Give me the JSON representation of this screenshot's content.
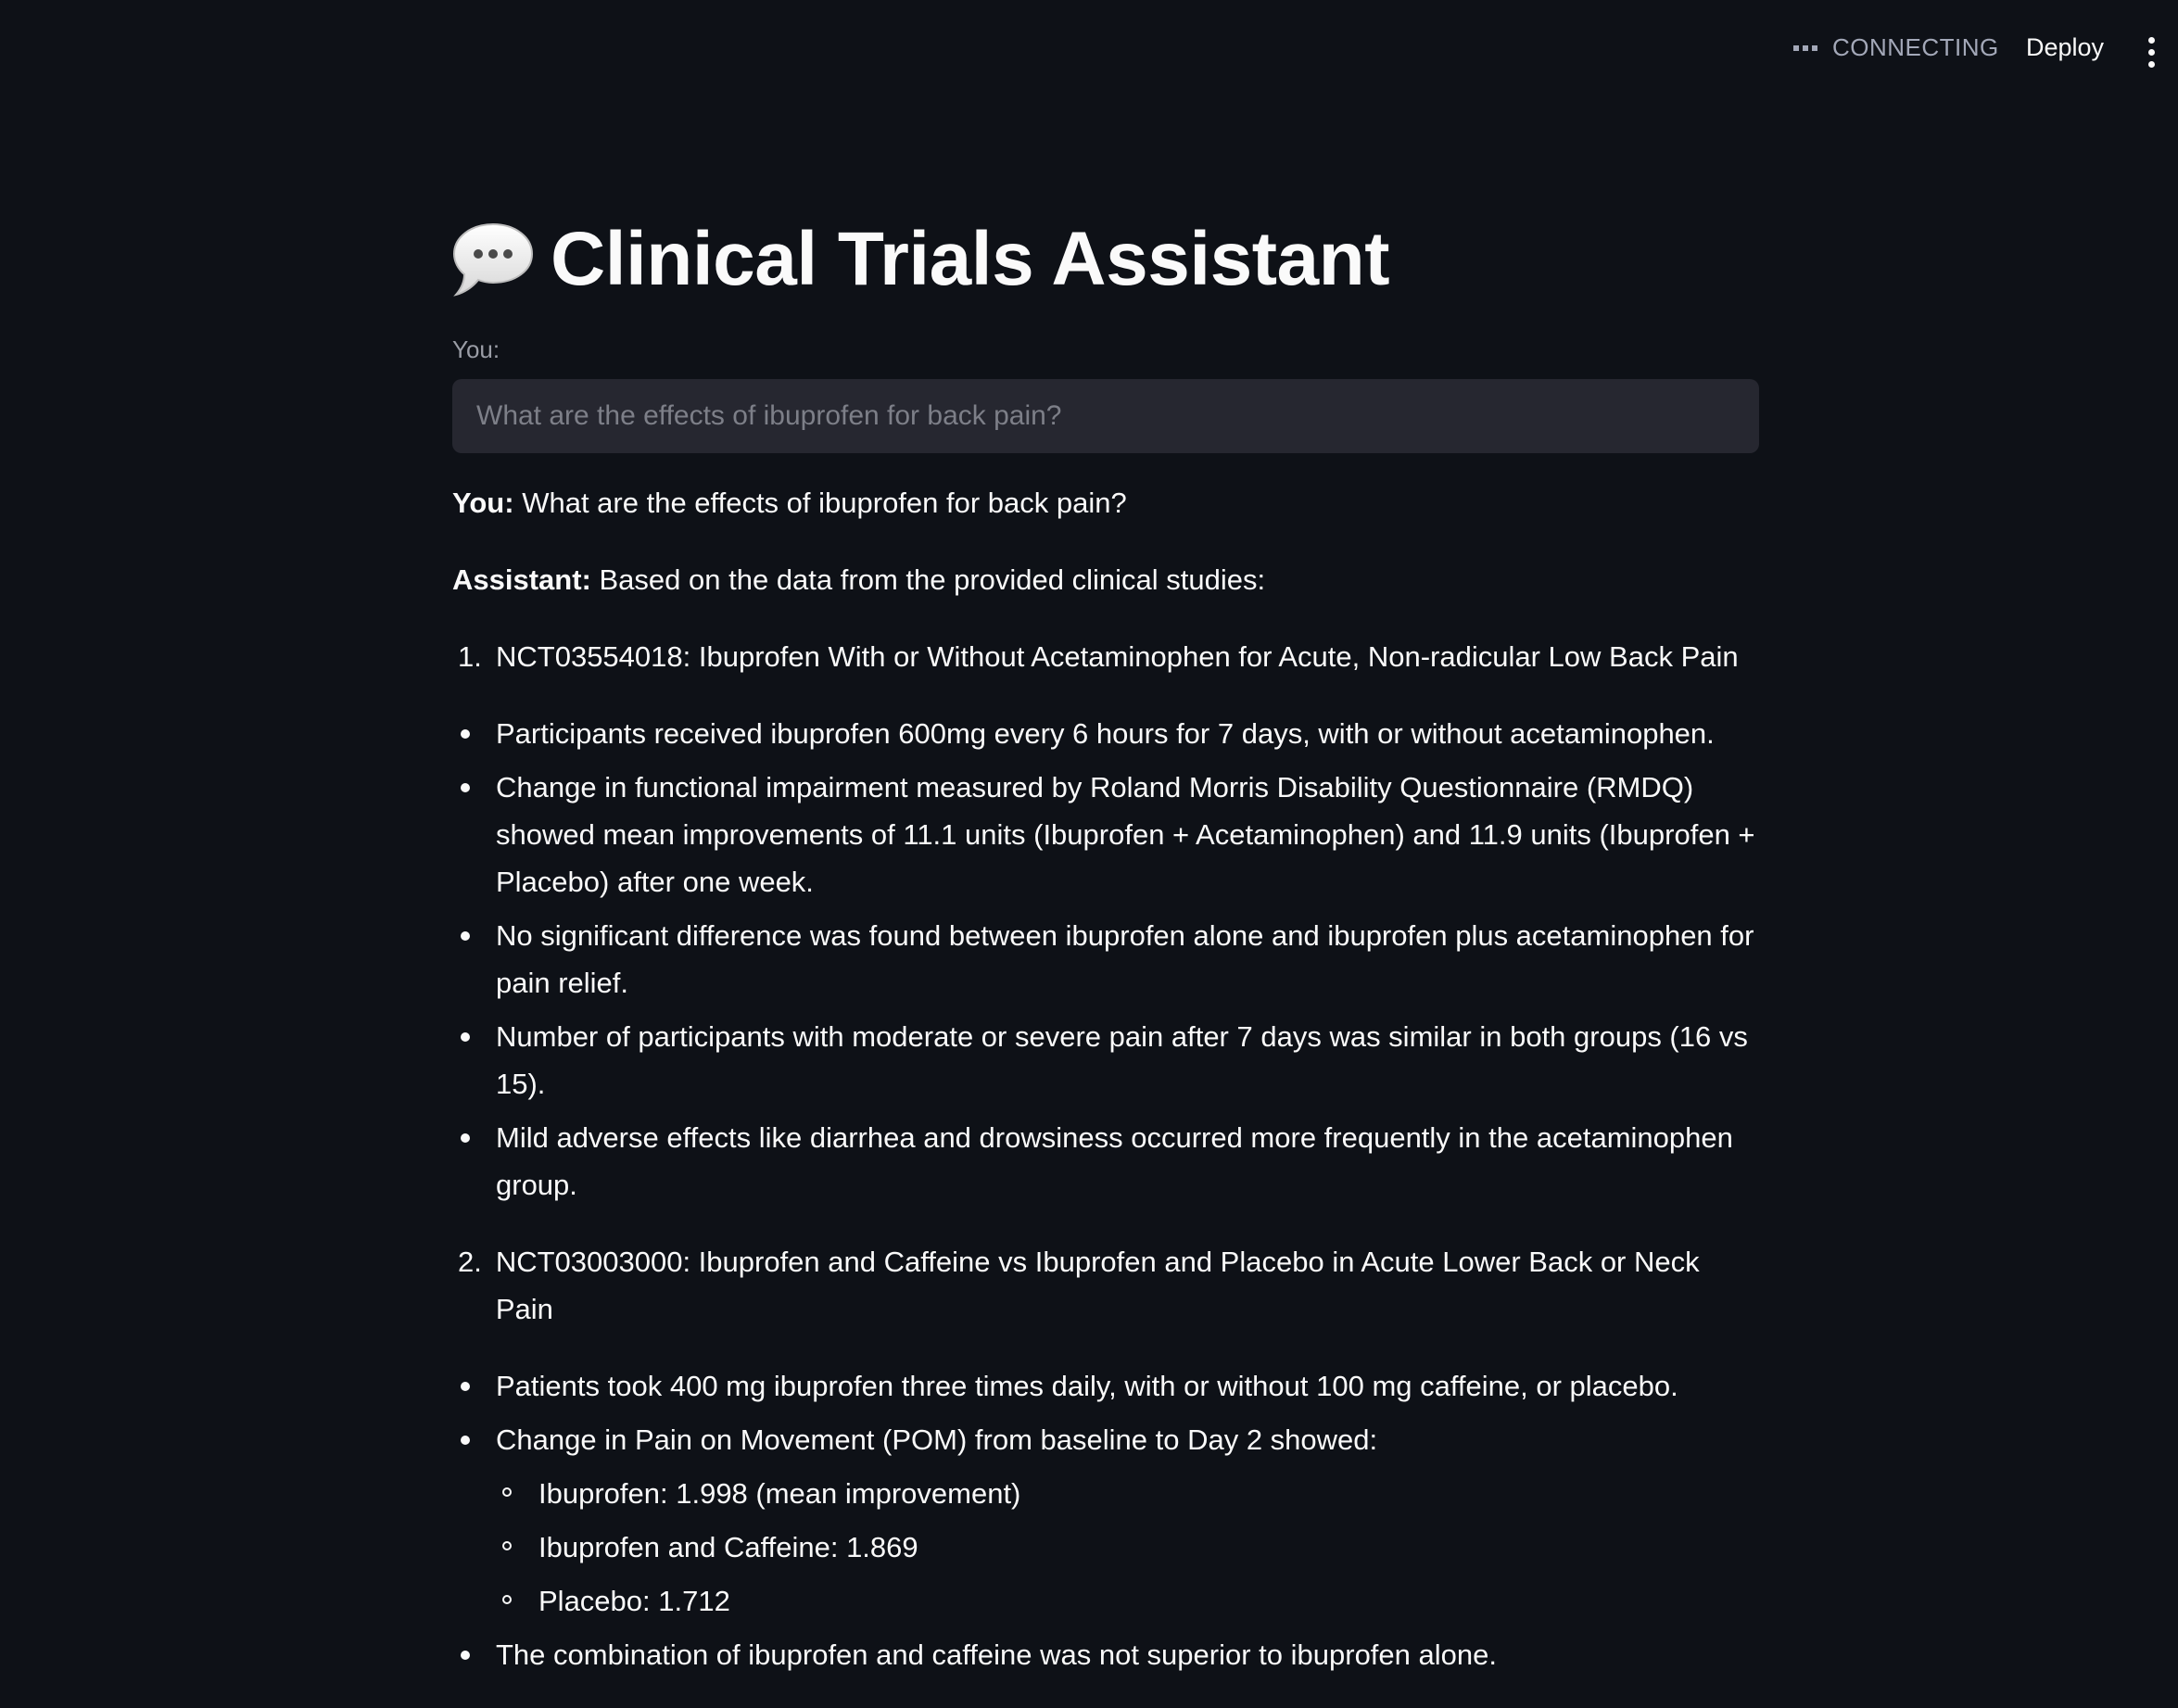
{
  "header": {
    "status_label": "CONNECTING",
    "status_icon": "connecting-dots-icon",
    "deploy_label": "Deploy",
    "menu_icon": "vertical-ellipsis-icon"
  },
  "page": {
    "title_icon": "speech-bubble-icon",
    "title": "Clinical Trials Assistant",
    "input_label": "You:",
    "input_placeholder": "What are the effects of ibuprofen for back pain?",
    "input_value": ""
  },
  "chat": {
    "user_label": "You:",
    "user_message": "What are the effects of ibuprofen for back pain?",
    "assistant_label": "Assistant:",
    "assistant_intro": "Based on the data from the provided clinical studies:",
    "studies": [
      {
        "number": "1.",
        "title": "NCT03554018: Ibuprofen With or Without Acetaminophen for Acute, Non-radicular Low Back Pain",
        "bullets": [
          "Participants received ibuprofen 600mg every 6 hours for 7 days, with or without acetaminophen.",
          "Change in functional impairment measured by Roland Morris Disability Questionnaire (RMDQ) showed mean improvements of 11.1 units (Ibuprofen + Acetaminophen) and 11.9 units (Ibuprofen + Placebo) after one week.",
          "No significant difference was found between ibuprofen alone and ibuprofen plus acetaminophen for pain relief.",
          "Number of participants with moderate or severe pain after 7 days was similar in both groups (16 vs 15).",
          "Mild adverse effects like diarrhea and drowsiness occurred more frequently in the acetaminophen group."
        ]
      },
      {
        "number": "2.",
        "title": "NCT03003000: Ibuprofen and Caffeine vs Ibuprofen and Placebo in Acute Lower Back or Neck Pain",
        "bullets": [
          "Patients took 400 mg ibuprofen three times daily, with or without 100 mg caffeine, or placebo.",
          "Change in Pain on Movement (POM) from baseline to Day 2 showed:",
          "The combination of ibuprofen and caffeine was not superior to ibuprofen alone."
        ],
        "sub_bullets": [
          "Ibuprofen: 1.998 (mean improvement)",
          "Ibuprofen and Caffeine: 1.869",
          "Placebo: 1.712"
        ]
      }
    ]
  }
}
